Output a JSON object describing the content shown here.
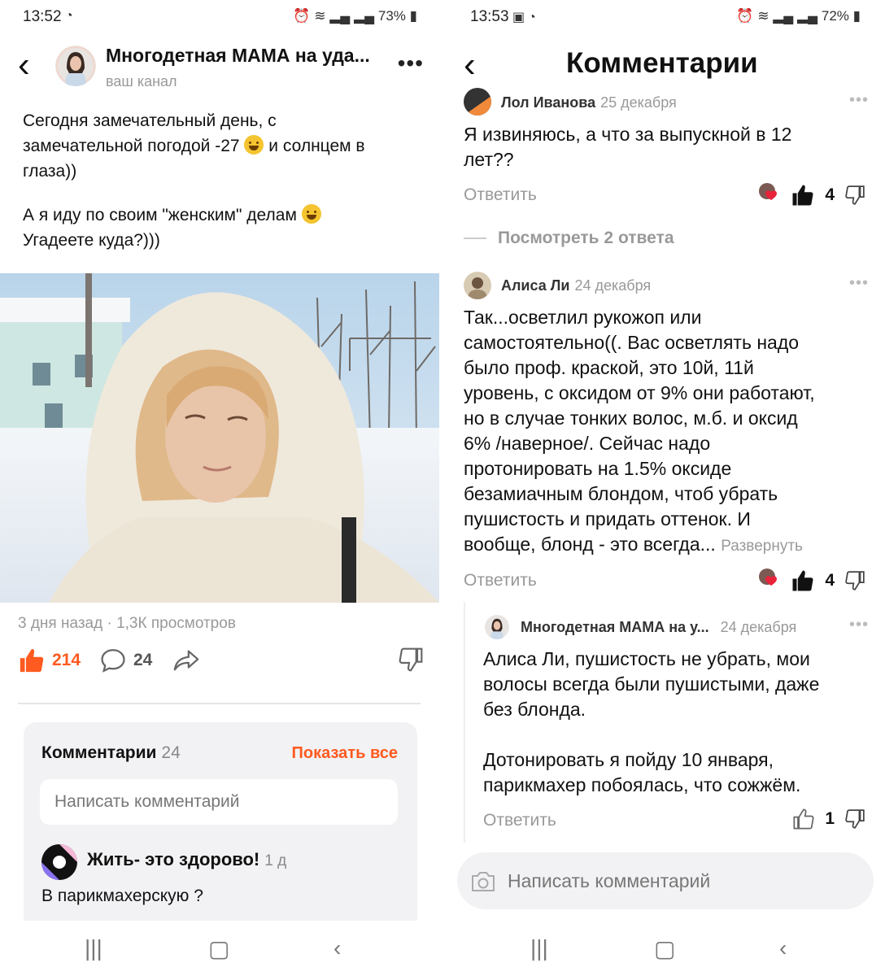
{
  "left": {
    "status": {
      "time": "13:52",
      "right": "73%"
    },
    "header": {
      "channel_name": "Многодетная МАМА на уда...",
      "subtitle": "ваш канал"
    },
    "post": {
      "paragraph1": [
        "Сегодня замечательный день, с",
        "замечательной погодой -27",
        "и солнцем в",
        "глаза))"
      ],
      "paragraph2": [
        "А я иду по своим \"женским\" делам",
        "Угадеете куда?)))"
      ],
      "meta": "3 дня назад · 1,3К просмотров",
      "likes": "214",
      "comments": "24"
    },
    "comments_box": {
      "title": "Комментарии",
      "count": "24",
      "show_all": "Показать все",
      "placeholder": "Написать комментарий",
      "first_comment": {
        "author": "Жить- это здорово!",
        "time": "1 д",
        "text": "В парикмахерскую ?"
      }
    }
  },
  "right": {
    "status": {
      "time": "13:53",
      "right": "72%"
    },
    "title": "Комментарии",
    "comment1": {
      "author": "Лол Иванова",
      "date": "25 декабря",
      "text": [
        "Я извиняюсь, а что за выпускной в 12",
        "лет??"
      ],
      "reply": "Ответить",
      "likes": "4",
      "view_replies": "Посмотреть 2 ответа"
    },
    "comment2": {
      "author": "Алиса Ли",
      "date": "24 декабря",
      "text": [
        "Так...осветлил рукожоп или",
        "самостоятельно((. Вас осветлять надо",
        "было проф. краской, это 10й, 11й",
        "уровень, с оксидом от 9% они работают,",
        "но в случае тонких волос, м.б. и оксид",
        "6% /наверное/. Сейчас надо",
        "протонировать на 1.5% оксиде",
        "безамиачным блондом, чтоб убрать",
        "пушистость и придать оттенок. И",
        "вообще, блонд - это всегда..."
      ],
      "expand": "Развернуть",
      "reply": "Ответить",
      "likes": "4"
    },
    "reply1": {
      "author": "Многодетная МАМА на у...",
      "date": "24 декабря",
      "text": [
        "Алиса Ли, пушистость не убрать, мои",
        "волосы всегда были пушистыми, даже",
        "без блонда.",
        "",
        "Дотонировать я пойду 10 января,",
        "парикмахер побоялась, что сожжём."
      ],
      "reply": "Ответить",
      "likes": "1"
    },
    "input_placeholder": "Написать комментарий"
  },
  "colors": {
    "accent": "#ff5a1f",
    "muted": "#999999",
    "box": "#f2f2f4"
  }
}
